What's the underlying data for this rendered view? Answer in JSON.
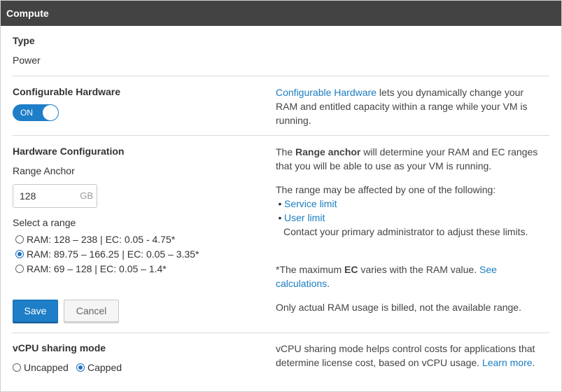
{
  "header": {
    "title": "Compute"
  },
  "type_section": {
    "label": "Type",
    "value": "Power"
  },
  "configurable_hardware": {
    "label": "Configurable Hardware",
    "toggle_label": "ON",
    "toggle_on": true,
    "desc_link": "Configurable Hardware",
    "desc_text": " lets you dynamically change your RAM and entitled capacity within a range while your VM is running."
  },
  "hardware_configuration": {
    "label": "Hardware Configuration",
    "range_anchor_label": "Range Anchor",
    "range_anchor_value": "128",
    "range_anchor_unit": "GB",
    "select_range_label": "Select a range",
    "ranges": [
      {
        "label": "RAM: 128 – 238 | EC: 0.05 - 4.75*",
        "checked": false
      },
      {
        "label": "RAM: 89.75 – 166.25 | EC: 0.05 – 3.35*",
        "checked": true
      },
      {
        "label": "RAM: 69 – 128 | EC: 0.05 – 1.4*",
        "checked": false
      }
    ],
    "save_label": "Save",
    "cancel_label": "Cancel",
    "desc1_pre": "The ",
    "desc1_bold": "Range anchor",
    "desc1_post": " will determine your RAM and EC ranges that you will be able to use as your VM is running.",
    "desc2": "The range may be affected by one of the following:",
    "bullet_char": "•",
    "service_limit": "Service limit",
    "user_limit": "User limit",
    "contact_text": "Contact your primary administrator to adjust these limits.",
    "desc3_pre": "*The maximum ",
    "desc3_bold": "EC",
    "desc3_post": " varies with the RAM value. ",
    "desc3_link": "See calculations",
    "desc3_end": ".",
    "desc4": "Only actual RAM usage is billed, not the available range."
  },
  "vcpu": {
    "label": "vCPU sharing mode",
    "options": [
      {
        "label": "Uncapped",
        "checked": false
      },
      {
        "label": "Capped",
        "checked": true
      }
    ],
    "desc_text": "vCPU sharing mode helps control costs for applications that determine license cost, based on vCPU usage. ",
    "desc_link": "Learn more",
    "desc_end": "."
  }
}
